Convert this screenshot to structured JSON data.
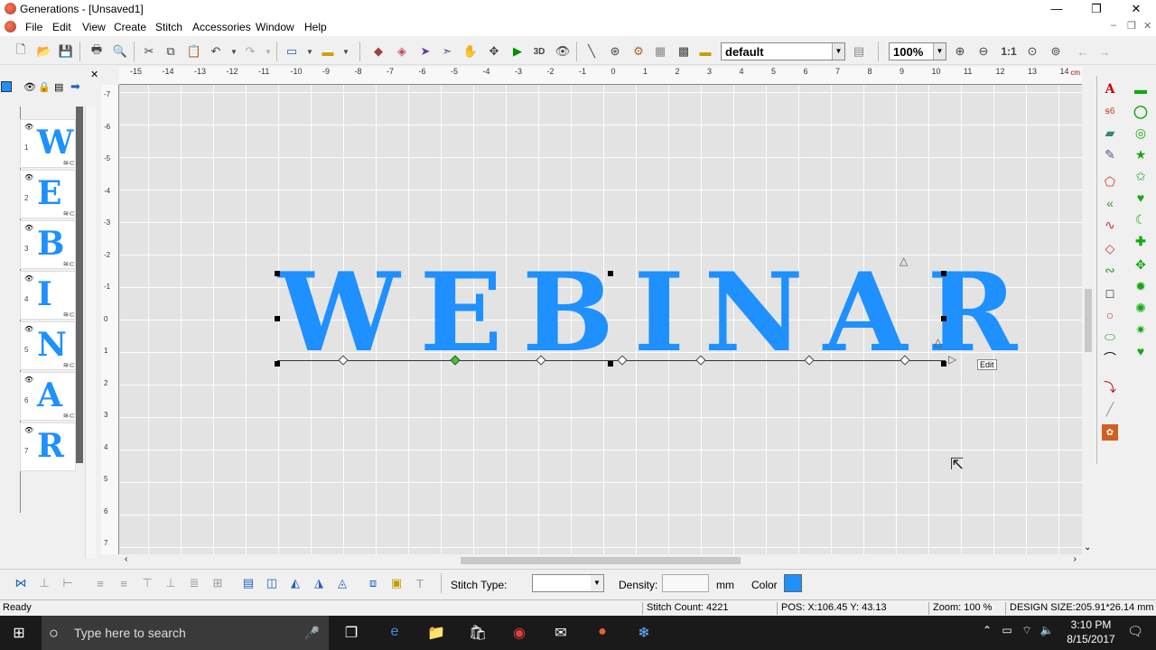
{
  "window": {
    "title": "Generations - [Unsaved1]",
    "min": "—",
    "restore": "❐",
    "close": "✕"
  },
  "menu": [
    "File",
    "Edit",
    "View",
    "Create",
    "Stitch",
    "Accessories",
    "Window",
    "Help"
  ],
  "toolbar": {
    "style_select": "default",
    "zoom_select": "100%",
    "zoom_actual": "1:1"
  },
  "ruler": {
    "h_ticks": [
      "-15",
      "-14",
      "-13",
      "-12",
      "-11",
      "-10",
      "-9",
      "-8",
      "-7",
      "-6",
      "-5",
      "-4",
      "-3",
      "-2",
      "-1",
      "0",
      "1",
      "2",
      "3",
      "4",
      "5",
      "6",
      "7",
      "8",
      "9",
      "10",
      "11",
      "12",
      "13",
      "14"
    ],
    "h_unit": "cm",
    "v_ticks": [
      "-7",
      "-6",
      "-5",
      "-4",
      "-3",
      "-2",
      "-1",
      "0",
      "1",
      "2",
      "3",
      "4",
      "5",
      "6",
      "7"
    ]
  },
  "layers": [
    {
      "letter": "W",
      "num": "1"
    },
    {
      "letter": "E",
      "num": "2"
    },
    {
      "letter": "B",
      "num": "3"
    },
    {
      "letter": "I",
      "num": "4"
    },
    {
      "letter": "N",
      "num": "5"
    },
    {
      "letter": "A",
      "num": "6"
    },
    {
      "letter": "R",
      "num": "7"
    }
  ],
  "canvas": {
    "text": "WEBINAR",
    "text_color": "#1e90ff",
    "edit_label": "Edit"
  },
  "properties": {
    "stitch_type_label": "Stitch Type:",
    "stitch_type_value": "",
    "density_label": "Density:",
    "density_value": "",
    "density_unit": "mm",
    "color_label": "Color",
    "color_value": "#1e90ff"
  },
  "status": {
    "ready": "Ready",
    "stitch_count": "Stitch Count: 4221",
    "pos": "POS: X:106.45    Y: 43.13",
    "zoom": "Zoom:  100 %",
    "design_size": "DESIGN SIZE:205.91*26.14 mm"
  },
  "taskbar": {
    "search_placeholder": "Type here to search",
    "time": "3:10 PM",
    "date": "8/15/2017"
  }
}
